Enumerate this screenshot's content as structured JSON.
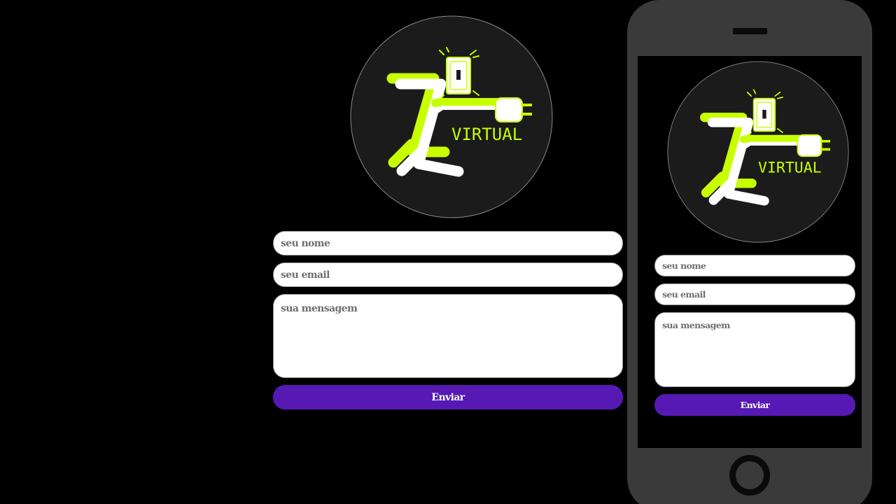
{
  "brand": {
    "logo_text": "VIRTUAL",
    "accent_color": "#c8ff00",
    "logo_bg": "#1b1b1b"
  },
  "desktop_form": {
    "name_placeholder": "seu nome",
    "email_placeholder": "seu email",
    "message_placeholder": "sua mensagem",
    "submit_label": "Enviar"
  },
  "mobile_form": {
    "name_placeholder": "seu nome",
    "email_placeholder": "seu email",
    "message_placeholder": "sua mensagem",
    "submit_label": "Enviar"
  },
  "colors": {
    "page_bg": "#000000",
    "button_bg": "#5619b3",
    "button_text": "#ffffff",
    "field_bg": "#ffffff",
    "phone_body": "#3a3a3a"
  }
}
